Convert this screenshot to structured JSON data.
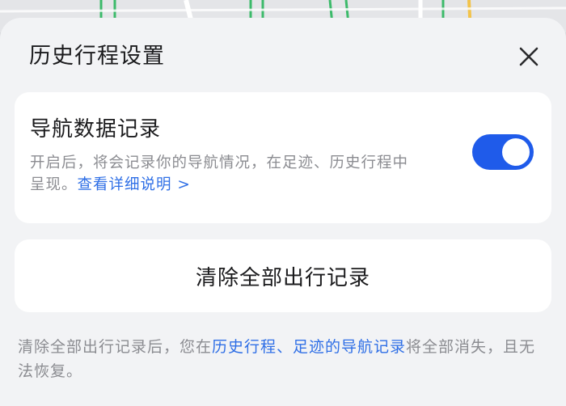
{
  "sheet": {
    "title": "历史行程设置",
    "close_icon": "close-icon"
  },
  "navigation_card": {
    "title": "导航数据记录",
    "description": "开启后，将会记录你的导航情况，在足迹、历史行程中呈现。",
    "detail_link": "查看详细说明 >",
    "toggle_on": true,
    "toggle_color": "#1f5bea"
  },
  "clear_card": {
    "label": "清除全部出行记录"
  },
  "footnote": {
    "prefix": "清除全部出行记录后，您在",
    "link": "历史行程、足迹的导航记录",
    "suffix": "将全部消失，且无法恢复。"
  },
  "colors": {
    "link": "#2f6fe6",
    "secondary_text": "#8b8c91",
    "primary_text": "#1b1b1d",
    "sheet_bg": "#f2f3f5"
  }
}
